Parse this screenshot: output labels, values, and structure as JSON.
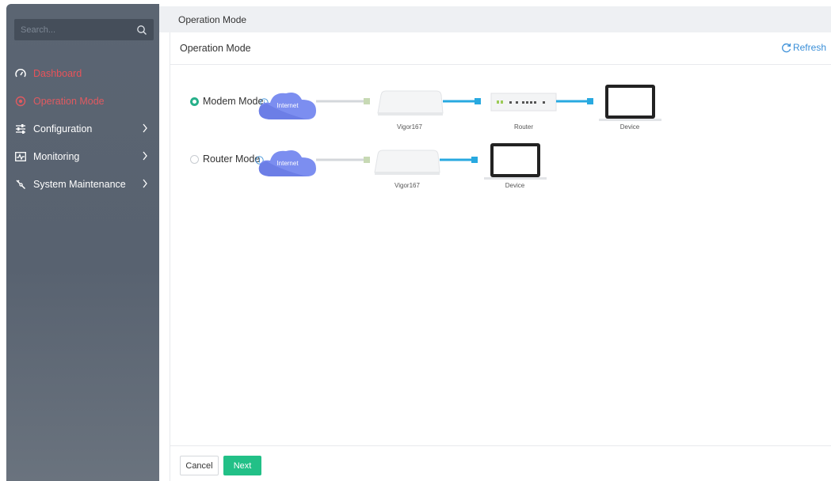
{
  "search": {
    "placeholder": "Search..."
  },
  "sidebar": {
    "items": [
      {
        "label": "Dashboard",
        "icon": "dashboard-icon"
      },
      {
        "label": "Operation Mode",
        "icon": "operation-mode-icon"
      },
      {
        "label": "Configuration",
        "icon": "configuration-icon"
      },
      {
        "label": "Monitoring",
        "icon": "monitoring-icon"
      },
      {
        "label": "System Maintenance",
        "icon": "system-maintenance-icon"
      }
    ]
  },
  "header": {
    "title": "Operation Mode"
  },
  "panel": {
    "title": "Operation Mode",
    "refresh_label": "Refresh",
    "modes": [
      {
        "label": "Modem Mode",
        "selected": true,
        "cloud_text": "Internet",
        "devices": [
          "Vigor167",
          "Router",
          "Device"
        ]
      },
      {
        "label": "Router Mode",
        "selected": false,
        "cloud_text": "Internet",
        "devices": [
          "Vigor167",
          "Device"
        ]
      }
    ]
  },
  "footer": {
    "cancel_label": "Cancel",
    "next_label": "Next"
  },
  "colors": {
    "accent_green": "#22c087",
    "active_red": "#e8535a",
    "link_blue": "#3a8fd8",
    "cable_blue": "#28a9e0",
    "cloud_blue": "#7a8cf0"
  }
}
